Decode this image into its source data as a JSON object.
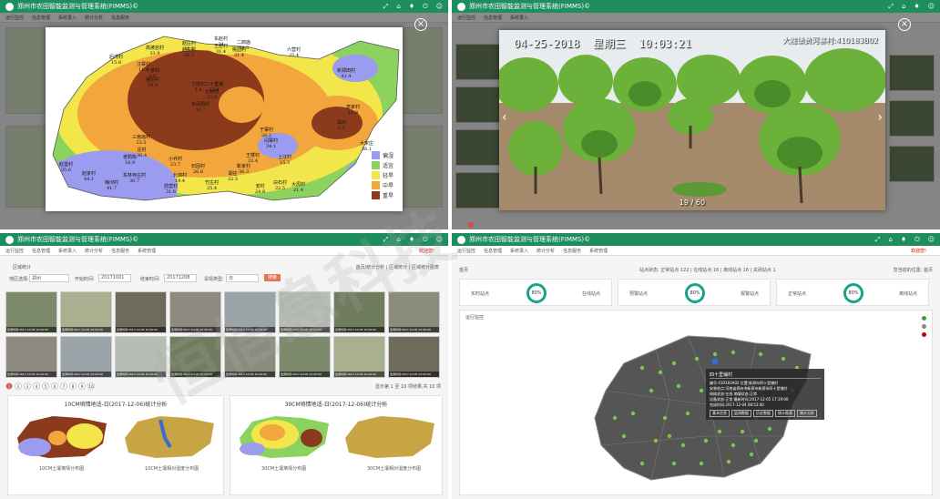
{
  "system_title": "郑州市农田智能监测与管理系统(FIMMS)©",
  "nav_menu": [
    "运行监控",
    "信息管理",
    "系统录入",
    "统计分析",
    "信息服务",
    "系统管理"
  ],
  "user": {
    "greeting": "欢迎您!",
    "name": "admin"
  },
  "top_left": {
    "legend": [
      "偏湿",
      "适宜",
      "轻旱",
      "中旱",
      "重旱"
    ],
    "legend_colors": [
      "#9b9bef",
      "#8bd35e",
      "#f2e64a",
      "#f2a63b",
      "#8b3a1c"
    ],
    "sites": [
      {
        "name": "赵庄村",
        "value": "31.5"
      },
      {
        "name": "东赵村",
        "value": "24"
      },
      {
        "name": "二郎庙",
        "value": "33.3"
      },
      {
        "name": "赵庄村",
        "value": "26.3"
      },
      {
        "name": "王庄村",
        "value": "31.4"
      },
      {
        "name": "桃园村",
        "value": "31.4"
      },
      {
        "name": "后湾村",
        "value": "15.8"
      },
      {
        "name": "高坡岩村",
        "value": "31.9"
      },
      {
        "name": "六营村",
        "value": "25.4"
      },
      {
        "name": "新郑田村",
        "value": "41.4"
      },
      {
        "name": "汪寨村",
        "value": "11.1"
      },
      {
        "name": "丁店村",
        "value": "5.4"
      },
      {
        "name": "十家村",
        "value": "9.6"
      },
      {
        "name": "二十里铺",
        "value": "23.8"
      },
      {
        "name": "北台村",
        "value": "23.9"
      },
      {
        "name": "吴庄村",
        "value": "10.9"
      },
      {
        "name": "东武周村",
        "value": "10.7"
      },
      {
        "name": "李家村",
        "value": "15.8"
      },
      {
        "name": "郑州",
        "value": "0.1"
      },
      {
        "name": "三宫庙村",
        "value": "23.5"
      },
      {
        "name": "于寨村",
        "value": "26.2"
      },
      {
        "name": "闫寨村",
        "value": "34.1"
      },
      {
        "name": "大宋庄",
        "value": "36.1"
      },
      {
        "name": "老鸦陈",
        "value": "16.9"
      },
      {
        "name": "庄村",
        "value": "30.4"
      },
      {
        "name": "小乔村",
        "value": "23.7"
      },
      {
        "name": "王楼村",
        "value": "22.4"
      },
      {
        "name": "上汪村",
        "value": "15.3"
      },
      {
        "name": "胡庄",
        "value": "22.5"
      },
      {
        "name": "石固村",
        "value": "26.6"
      },
      {
        "name": "靳家村",
        "value": "36.3"
      },
      {
        "name": "赵堡村",
        "value": "35.6"
      },
      {
        "name": "赵家村",
        "value": "44.1"
      },
      {
        "name": "梅河村",
        "value": "41.7"
      },
      {
        "name": "东林寺庄村",
        "value": "36.7"
      },
      {
        "name": "北泗村",
        "value": "19.4"
      },
      {
        "name": "前营村",
        "value": "31.6"
      },
      {
        "name": "竹庄村",
        "value": "25.4"
      },
      {
        "name": "安村",
        "value": "24.8"
      },
      {
        "name": "白石村",
        "value": "22.5"
      },
      {
        "name": "大周村",
        "value": "21.4"
      }
    ]
  },
  "top_right": {
    "datetime": "04-25-2018  星期三  10:03:21",
    "camera": "大隗镇黄河寨村:410183B02",
    "counter": "19 / 60"
  },
  "bottom_left": {
    "section_title": "区域统计",
    "filters": {
      "region_label": "地区选择:",
      "region_value": "郑州",
      "start_label": "开始时间:",
      "start_value": "20171001",
      "end_label": "结束时间:",
      "end_value": "20171208",
      "type_label": "旱情类型:",
      "type_value": "日",
      "search_label": "搜索"
    },
    "breadcrumb": "首页/统计分析 | 区域统计 | 区域统计图表",
    "photo_caption": "监测时间:2017-10-05 10:00:00",
    "pager": [
      "1",
      "2",
      "3",
      "4",
      "5",
      "6",
      "7",
      "8",
      "9",
      "10"
    ],
    "pager_info": "显示第 1 至 10 项结果,共 10 项",
    "chart_titles": [
      "10CM墒情地适-日(2017-12-06)统计分析",
      "30CM墒情地适-日(2017-12-06)统计分析"
    ],
    "map_labels": [
      "10CM土壤墒情分布图",
      "10CM土壤相对湿度分布图",
      "30CM土壤墒情分布图",
      "30CM土壤相对湿度分布图"
    ]
  },
  "bottom_right": {
    "section_title": "首页",
    "stats_text": "站点状态: 正常站点 122 | 在线站点 16 | 离线站点 16 | 关闭站点 1",
    "breadcrumb": "您当前的位置: 首页",
    "cards": [
      {
        "left": "实时站点",
        "pct": "80%",
        "right": "在线站点"
      },
      {
        "left": "预警站点",
        "pct": "80%",
        "right": "报警站点"
      },
      {
        "left": "正常站点",
        "pct": "80%",
        "right": "离线站点"
      }
    ],
    "map_section": "运行监控",
    "popup": {
      "title": "四十里铺村",
      "lines": [
        "编号:410183A02  位置:新郑市四十里铺村",
        "安装地点:河南省郑州市新郑市新郑市四十里铺村",
        "网络状态:在线  墒情状态:正常",
        "设备状态:正常  最新时间:2017-12-05 17:19:00",
        "完成时间:2017-12-04 08:52:40"
      ],
      "buttons": [
        "基本信息",
        "监测数据",
        "历史数据",
        "统计图表",
        "统计分析"
      ]
    },
    "legend_colors": [
      "#3aa03a",
      "#888888",
      "#c00000"
    ]
  },
  "watermark": "恒信息科技"
}
